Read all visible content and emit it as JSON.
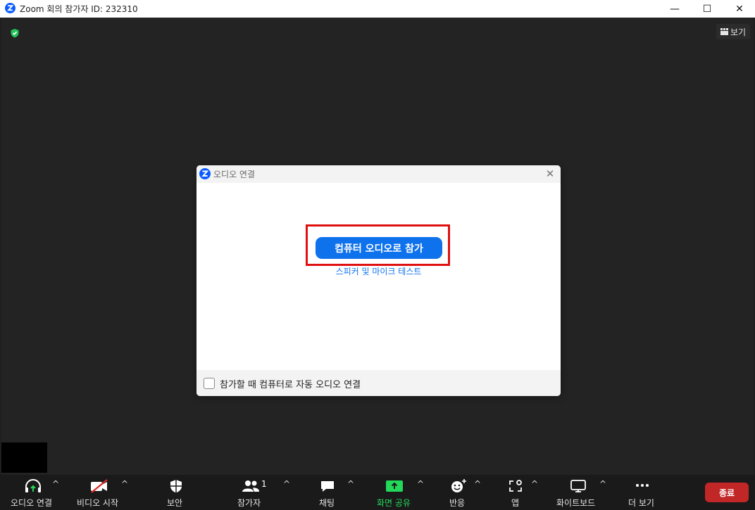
{
  "window": {
    "title": "Zoom 회의 참가자 ID: 232310",
    "minimize": "—",
    "maximize": "☐",
    "close": "✕"
  },
  "meeting": {
    "view_label": "보기"
  },
  "dialog": {
    "title": "오디오 연결",
    "join_button": "컴퓨터 오디오로 참가",
    "test_link": "스피커 및 마이크 테스트",
    "auto_join_label": "참가할 때 컴퓨터로 자동 오디오 연결",
    "auto_join_checked": false
  },
  "toolbar": {
    "items": [
      {
        "label": "오디오 연결",
        "icon": "headphone-icon"
      },
      {
        "label": "비디오 시작",
        "icon": "video-off-icon"
      },
      {
        "label": "보안",
        "icon": "shield-icon"
      },
      {
        "label": "참가자",
        "icon": "participants-icon",
        "count": "1"
      },
      {
        "label": "채팅",
        "icon": "chat-icon"
      },
      {
        "label": "화면 공유",
        "icon": "share-screen-icon"
      },
      {
        "label": "반응",
        "icon": "reaction-icon"
      },
      {
        "label": "앱",
        "icon": "apps-icon"
      },
      {
        "label": "화이트보드",
        "icon": "whiteboard-icon"
      },
      {
        "label": "더 보기",
        "icon": "more-icon"
      }
    ],
    "end_button": "종료"
  },
  "colors": {
    "accent": "#0e72ed",
    "share_green": "#23d959",
    "end_red": "#c12727",
    "highlight_red": "#e01010"
  }
}
